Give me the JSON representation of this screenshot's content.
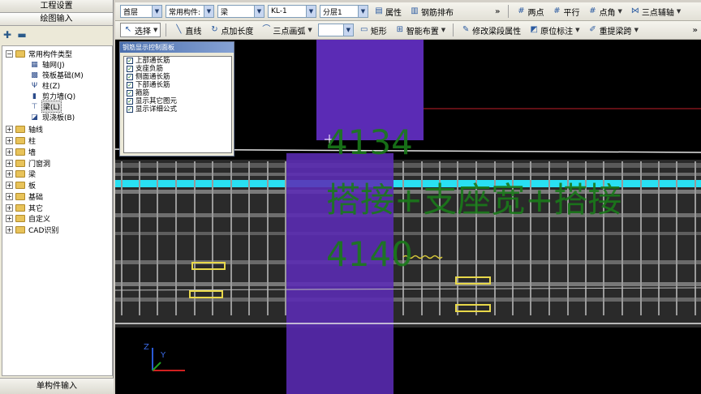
{
  "left_panel": {
    "tab_project": "工程设置",
    "tab_drawing": "绘图输入",
    "tab_single": "单构件输入",
    "tree": {
      "root": "常用构件类型",
      "children": [
        {
          "label": "轴网(J)",
          "icon": "grid-icon"
        },
        {
          "label": "筏板基础(M)",
          "icon": "raft-foundation-icon"
        },
        {
          "label": "柱(Z)",
          "icon": "column-icon"
        },
        {
          "label": "剪力墙(Q)",
          "icon": "shear-wall-icon"
        },
        {
          "label": "梁(L)",
          "icon": "beam-icon"
        },
        {
          "label": "现浇板(B)",
          "icon": "slab-icon"
        }
      ],
      "groups": [
        "轴线",
        "柱",
        "墙",
        "门窗洞",
        "梁",
        "板",
        "基础",
        "其它",
        "自定义",
        "CAD识别"
      ]
    }
  },
  "toolbar1": {
    "floor": "首层",
    "component_type": "常用构件:",
    "component": "梁",
    "name": "KL-1",
    "layer": "分层1",
    "attr_btn": "属性",
    "rebar_btn": "钢筋排布",
    "twopoint_btn": "两点",
    "parallel_btn": "平行",
    "angle_btn": "点角",
    "threepoint_axis_btn": "三点辅轴"
  },
  "toolbar2": {
    "select_btn": "选择",
    "line_btn": "直线",
    "point_length_btn": "点加长度",
    "arc_btn": "三点画弧",
    "rect_btn": "矩形",
    "smart_btn": "智能布置",
    "modify_btn": "修改梁段属性",
    "original_btn": "原位标注",
    "redraw_btn": "重提梁跨"
  },
  "rebar_panel": {
    "title": "钢筋显示控制面板",
    "options": [
      "上部通长筋",
      "支座负筋",
      "侧面通长筋",
      "下部通长筋",
      "箍筋",
      "显示其它图元",
      "显示详细公式"
    ]
  },
  "canvas": {
    "text_1": "4134",
    "text_2": "搭接+支座宽+搭接",
    "text_3": "4140",
    "axis_z": "Z",
    "axis_y": "Y",
    "colors": {
      "beam_cyan": "#29e0f2",
      "column_purple": "#5b2bb5",
      "text_green": "#1a7a1a",
      "red_line": "#c0202a"
    }
  }
}
